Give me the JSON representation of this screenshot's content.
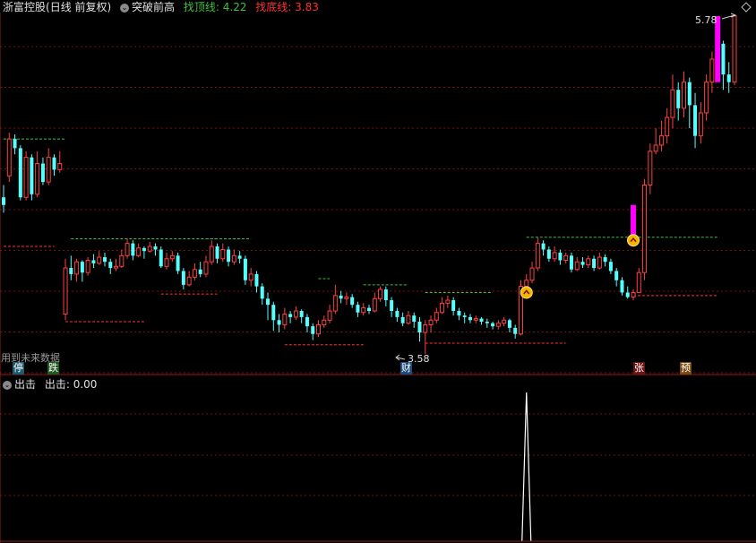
{
  "header": {
    "stock_name": "浙富控股",
    "period_label": "(日线 前复权)",
    "indicator_name": "突破前高",
    "top_line_label": "找顶线:",
    "top_line_value": "4.22",
    "bottom_line_label": "找底线:",
    "bottom_line_value": "3.83",
    "top_right_icon": "diamond-icon"
  },
  "annotations": {
    "high_price": "5.78",
    "low_price": "3.58",
    "future_data_note": "用到未来数据"
  },
  "event_badges": [
    {
      "id": "ting",
      "text": "停",
      "bg": "#1e5a70",
      "fg": "#ffffff"
    },
    {
      "id": "die",
      "text": "跌",
      "bg": "#1f5a1f",
      "fg": "#ffffff"
    },
    {
      "id": "cai",
      "text": "财",
      "bg": "#1e4a7a",
      "fg": "#ffffff"
    },
    {
      "id": "zhang",
      "text": "张",
      "bg": "#6a1414",
      "fg": "#ffffff"
    },
    {
      "id": "yu",
      "text": "预",
      "bg": "#7a4a10",
      "fg": "#ffffff"
    }
  ],
  "sub_panel": {
    "title": "出击",
    "value_label": "出击:",
    "value": "0.00"
  },
  "colors": {
    "up": "#ff4040",
    "down": "#54ffff",
    "grid": "#7a1010",
    "magenta": "#ff00ff",
    "signal": "#f5b400",
    "resistance": "#3ec03e",
    "support": "#ff3030"
  },
  "chart_data": {
    "type": "candlestick",
    "y_range_shown": [
      3.58,
      5.78
    ],
    "candles": [
      [
        4.6,
        4.55,
        4.68,
        4.5
      ],
      [
        4.74,
        4.98,
        5.02,
        4.7
      ],
      [
        4.98,
        4.92,
        5.01,
        4.88
      ],
      [
        4.92,
        4.6,
        4.94,
        4.58
      ],
      [
        4.6,
        4.86,
        4.9,
        4.58
      ],
      [
        4.86,
        4.62,
        4.88,
        4.58
      ],
      [
        4.62,
        4.82,
        4.9,
        4.6
      ],
      [
        4.82,
        4.7,
        4.86,
        4.68
      ],
      [
        4.7,
        4.86,
        4.92,
        4.68
      ],
      [
        4.86,
        4.78,
        4.88,
        4.74
      ],
      [
        4.78,
        4.82,
        4.9,
        4.76
      ],
      [
        3.84,
        4.14,
        4.2,
        3.8
      ],
      [
        4.14,
        4.1,
        4.22,
        4.06
      ],
      [
        4.1,
        4.18,
        4.2,
        4.05
      ],
      [
        4.18,
        4.11,
        4.19,
        4.05
      ],
      [
        4.11,
        4.19,
        4.21,
        4.09
      ],
      [
        4.19,
        4.17,
        4.23,
        4.14
      ],
      [
        4.17,
        4.21,
        4.25,
        4.16
      ],
      [
        4.21,
        4.18,
        4.24,
        4.15
      ],
      [
        4.18,
        4.14,
        4.2,
        4.1
      ],
      [
        4.14,
        4.15,
        4.2,
        4.12
      ],
      [
        4.15,
        4.22,
        4.26,
        4.14
      ],
      [
        4.22,
        4.3,
        4.33,
        4.2
      ],
      [
        4.3,
        4.22,
        4.32,
        4.19
      ],
      [
        4.22,
        4.27,
        4.3,
        4.21
      ],
      [
        4.27,
        4.25,
        4.28,
        4.2
      ],
      [
        4.25,
        4.28,
        4.31,
        4.24
      ],
      [
        4.28,
        4.26,
        4.3,
        4.22
      ],
      [
        4.26,
        4.15,
        4.28,
        4.14
      ],
      [
        4.15,
        4.2,
        4.24,
        4.13
      ],
      [
        4.2,
        4.22,
        4.25,
        4.18
      ],
      [
        4.22,
        4.12,
        4.24,
        4.1
      ],
      [
        4.12,
        4.03,
        4.14,
        4.0
      ],
      [
        4.03,
        4.08,
        4.12,
        4.02
      ],
      [
        4.08,
        4.13,
        4.17,
        4.06
      ],
      [
        4.13,
        4.1,
        4.18,
        4.08
      ],
      [
        4.1,
        4.18,
        4.22,
        4.08
      ],
      [
        4.18,
        4.28,
        4.32,
        4.16
      ],
      [
        4.28,
        4.2,
        4.3,
        4.17
      ],
      [
        4.2,
        4.26,
        4.3,
        4.18
      ],
      [
        4.26,
        4.18,
        4.28,
        4.15
      ],
      [
        4.18,
        4.22,
        4.26,
        4.16
      ],
      [
        4.22,
        4.2,
        4.25,
        4.17
      ],
      [
        4.2,
        4.06,
        4.22,
        4.03
      ],
      [
        4.06,
        4.1,
        4.14,
        4.02
      ],
      [
        4.1,
        4.02,
        4.12,
        3.98
      ],
      [
        4.02,
        3.94,
        4.04,
        3.9
      ],
      [
        3.94,
        3.9,
        3.98,
        3.8
      ],
      [
        3.9,
        3.8,
        3.92,
        3.73
      ],
      [
        3.8,
        3.77,
        3.84,
        3.72
      ],
      [
        3.77,
        3.84,
        3.88,
        3.74
      ],
      [
        3.84,
        3.82,
        3.86,
        3.78
      ],
      [
        3.82,
        3.86,
        3.89,
        3.8
      ],
      [
        3.86,
        3.82,
        3.87,
        3.78
      ],
      [
        3.82,
        3.76,
        3.84,
        3.72
      ],
      [
        3.76,
        3.71,
        3.78,
        3.67
      ],
      [
        3.71,
        3.77,
        3.8,
        3.69
      ],
      [
        3.77,
        3.8,
        3.83,
        3.75
      ],
      [
        3.8,
        3.86,
        3.9,
        3.78
      ],
      [
        3.86,
        3.96,
        4.03,
        3.84
      ],
      [
        3.96,
        3.94,
        3.99,
        3.91
      ],
      [
        3.94,
        3.95,
        3.98,
        3.9
      ],
      [
        3.95,
        3.9,
        3.97,
        3.88
      ],
      [
        3.9,
        3.85,
        3.92,
        3.82
      ],
      [
        3.85,
        3.88,
        3.91,
        3.83
      ],
      [
        3.88,
        3.86,
        3.9,
        3.84
      ],
      [
        3.86,
        3.94,
        3.98,
        3.85
      ],
      [
        3.94,
        4.0,
        4.02,
        3.92
      ],
      [
        4.0,
        3.93,
        4.02,
        3.89
      ],
      [
        3.93,
        3.86,
        3.95,
        3.82
      ],
      [
        3.86,
        3.82,
        3.88,
        3.79
      ],
      [
        3.82,
        3.78,
        3.85,
        3.76
      ],
      [
        3.78,
        3.83,
        3.86,
        3.77
      ],
      [
        3.83,
        3.79,
        3.85,
        3.75
      ],
      [
        3.79,
        3.72,
        3.82,
        3.66
      ],
      [
        3.72,
        3.77,
        3.8,
        3.58
      ],
      [
        3.77,
        3.8,
        3.83,
        3.72
      ],
      [
        3.8,
        3.85,
        3.88,
        3.78
      ],
      [
        3.85,
        3.91,
        3.95,
        3.84
      ],
      [
        3.91,
        3.93,
        3.96,
        3.88
      ],
      [
        3.93,
        3.86,
        3.95,
        3.83
      ],
      [
        3.86,
        3.83,
        3.88,
        3.8
      ],
      [
        3.83,
        3.82,
        3.85,
        3.78
      ],
      [
        3.82,
        3.8,
        3.84,
        3.78
      ],
      [
        3.8,
        3.81,
        3.83,
        3.78
      ],
      [
        3.81,
        3.79,
        3.82,
        3.77
      ],
      [
        3.79,
        3.78,
        3.81,
        3.75
      ],
      [
        3.78,
        3.76,
        3.79,
        3.74
      ],
      [
        3.76,
        3.78,
        3.8,
        3.74
      ],
      [
        3.78,
        3.8,
        3.82,
        3.76
      ],
      [
        3.8,
        3.75,
        3.81,
        3.72
      ],
      [
        3.75,
        3.71,
        3.77,
        3.68
      ],
      [
        3.71,
        4.02,
        4.06,
        3.7
      ],
      [
        4.02,
        4.06,
        4.1,
        3.99
      ],
      [
        4.06,
        4.14,
        4.18,
        4.04
      ],
      [
        4.14,
        4.3,
        4.34,
        4.12
      ],
      [
        4.3,
        4.26,
        4.32,
        4.22
      ],
      [
        4.26,
        4.2,
        4.28,
        4.18
      ],
      [
        4.2,
        4.24,
        4.28,
        4.18
      ],
      [
        4.24,
        4.19,
        4.26,
        4.16
      ],
      [
        4.19,
        4.22,
        4.24,
        4.17
      ],
      [
        4.22,
        4.13,
        4.24,
        4.11
      ],
      [
        4.13,
        4.18,
        4.21,
        4.12
      ],
      [
        4.18,
        4.16,
        4.21,
        4.14
      ],
      [
        4.16,
        4.2,
        4.22,
        4.14
      ],
      [
        4.2,
        4.14,
        4.22,
        4.12
      ],
      [
        4.14,
        4.21,
        4.24,
        4.13
      ],
      [
        4.21,
        4.18,
        4.23,
        4.15
      ],
      [
        4.18,
        4.12,
        4.2,
        4.1
      ],
      [
        4.12,
        4.06,
        4.14,
        4.02
      ],
      [
        4.06,
        3.98,
        4.08,
        3.96
      ],
      [
        3.98,
        3.95,
        4.02,
        3.94
      ],
      [
        3.95,
        3.98,
        4.0,
        3.93
      ],
      [
        3.98,
        4.11,
        4.14,
        3.98
      ],
      [
        4.11,
        4.68,
        4.72,
        4.06
      ],
      [
        4.68,
        4.9,
        4.95,
        4.62
      ],
      [
        4.9,
        4.94,
        5.05,
        4.88
      ],
      [
        4.94,
        5.0,
        5.1,
        4.9
      ],
      [
        5.0,
        5.12,
        5.18,
        4.95
      ],
      [
        5.12,
        5.3,
        5.4,
        5.05
      ],
      [
        5.3,
        5.18,
        5.35,
        5.1
      ],
      [
        5.18,
        5.35,
        5.42,
        5.12
      ],
      [
        5.35,
        5.2,
        5.38,
        5.05
      ],
      [
        5.2,
        5.0,
        5.28,
        4.92
      ],
      [
        5.0,
        5.15,
        5.22,
        4.95
      ],
      [
        5.15,
        5.35,
        5.4,
        5.1
      ],
      [
        5.35,
        5.5,
        5.55,
        5.28
      ],
      [
        5.5,
        5.6,
        5.65,
        5.38
      ],
      [
        5.6,
        5.4,
        5.62,
        5.3
      ],
      [
        5.4,
        5.35,
        5.48,
        5.28
      ],
      [
        5.35,
        5.78,
        5.78,
        5.33
      ]
    ],
    "start_prices": [
      4.6,
      4.74,
      4.98,
      4.92,
      4.6,
      4.86,
      4.62,
      4.82,
      4.7,
      4.86,
      4.78
    ],
    "resistance_levels": [
      4.98,
      4.33,
      4.33,
      4.07,
      4.03,
      3.98,
      4.34
    ],
    "support_levels": [
      4.28,
      3.79,
      3.97,
      3.64,
      3.65,
      3.96
    ],
    "signal_points": [
      3.98,
      4.32
    ],
    "sub_indicator": {
      "name": "出击",
      "value": 0.0,
      "spike_value": 1.0
    }
  }
}
